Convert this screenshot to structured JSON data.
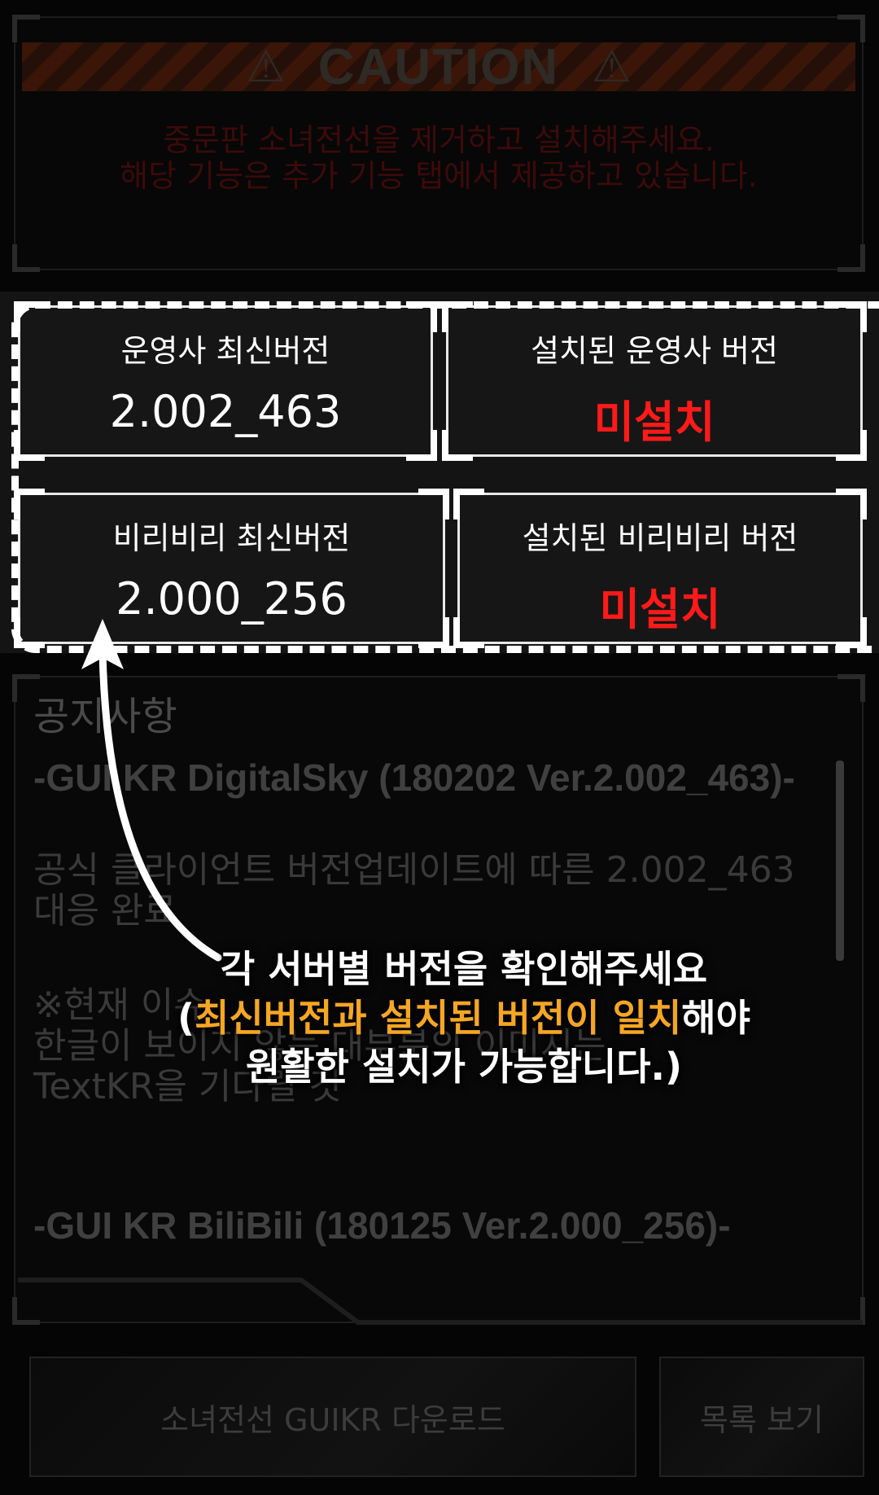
{
  "caution": {
    "title": "CAUTION",
    "icon": "warning-triangle-icon",
    "message_line1": "중문판 소녀전선을 제거하고 설치해주세요.",
    "message_line2": "해당 기능은 추가 기능 탭에서 제공하고 있습니다."
  },
  "versions": {
    "publisher_latest": {
      "label": "운영사 최신버전",
      "value": "2.002_463"
    },
    "publisher_installed": {
      "label": "설치된 운영사 버전",
      "value": "미설치"
    },
    "bilibili_latest": {
      "label": "비리비리 최신버전",
      "value": "2.000_256"
    },
    "bilibili_installed": {
      "label": "설치된 비리비리 버전",
      "value": "미설치"
    }
  },
  "notice": {
    "title": "공지사항",
    "entry1_heading": "-GUI KR DigitalSky (180202 Ver.2.002_463)-",
    "entry1_line1": "공식 클라이언트 버전업데이트에 따른 2.002_463",
    "entry1_line2": "대응 완료",
    "entry1_note1": "※현재 이슈",
    "entry1_note2": "한글이 보이지 않는 대부분의 이미지는",
    "entry1_note3": "TextKR을 기다릴 것",
    "entry2_heading": "-GUI KR BiliBili (180125 Ver.2.000_256)-"
  },
  "buttons": {
    "download": "소녀전선 GUIKR 다운로드",
    "list": "목록 보기"
  },
  "annotation": {
    "line1": "각 서버별 버전을 확인해주세요",
    "line2_open": "(",
    "line2_highlight": "최신버전과 설치된 버전이 일치",
    "line2_rest": "해야",
    "line3": "원활한 설치가 가능합니다.)"
  },
  "colors": {
    "highlight": "#f5a623",
    "not_installed": "#ff1a1a",
    "caution_text": "#3d0a0a"
  }
}
